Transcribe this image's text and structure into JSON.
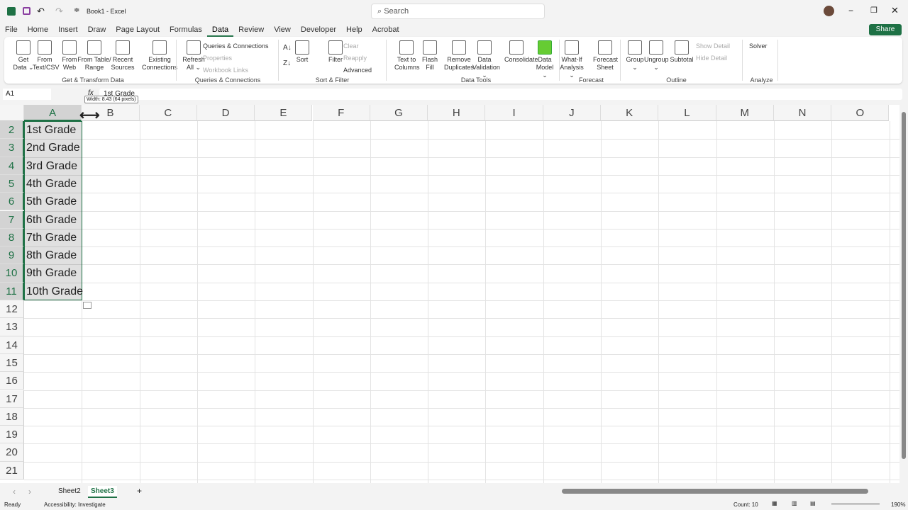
{
  "title": "Book1 - Excel",
  "search_placeholder": "Search",
  "menu": [
    "File",
    "Home",
    "Insert",
    "Draw",
    "Page Layout",
    "Formulas",
    "Data",
    "Review",
    "View",
    "Developer",
    "Help",
    "Acrobat"
  ],
  "share": "Share",
  "ribbon": {
    "big": [
      [
        "Get",
        "Data ⌄"
      ],
      [
        "From",
        "Text/CSV"
      ],
      [
        "From",
        "Web"
      ],
      [
        "From Table/",
        "Range"
      ],
      [
        "Recent",
        "Sources"
      ],
      [
        "Existing",
        "Connections"
      ],
      [
        "Refresh",
        "All ⌄"
      ],
      [
        "Sort",
        ""
      ],
      [
        "Filter",
        ""
      ],
      [
        "Text to",
        "Columns"
      ],
      [
        "Flash",
        "Fill"
      ],
      [
        "Remove",
        "Duplicates"
      ],
      [
        "Data",
        "Validation ⌄"
      ],
      [
        "Consolidate",
        ""
      ],
      [
        "Data",
        "Model ⌄"
      ],
      [
        "What-If",
        "Analysis ⌄"
      ],
      [
        "Forecast",
        "Sheet"
      ],
      [
        "Group",
        "⌄"
      ],
      [
        "Ungroup",
        "⌄"
      ],
      [
        "Subtotal",
        ""
      ]
    ],
    "small": [
      "Queries & Connections",
      "Properties",
      "Workbook Links",
      "Clear",
      "Reapply",
      "Advanced",
      "Show Detail",
      "Hide Detail",
      "Solver"
    ],
    "groups": [
      "Get & Transform Data",
      "Queries & Connections",
      "Sort & Filter",
      "Data Tools",
      "Forecast",
      "Outline",
      "Analyze"
    ]
  },
  "namebox": "A1",
  "formula": "1st Grade",
  "tooltip": "Width: 8.43 (64 pixels)",
  "columns": [
    "A",
    "B",
    "C",
    "D",
    "E",
    "F",
    "G",
    "H",
    "I",
    "J",
    "K",
    "L",
    "M",
    "N",
    "O"
  ],
  "rows": [
    "2",
    "3",
    "4",
    "5",
    "6",
    "7",
    "8",
    "9",
    "10",
    "11",
    "12",
    "13",
    "14",
    "15",
    "16",
    "17",
    "18",
    "19",
    "20",
    "21"
  ],
  "cells": [
    "1st Grade",
    "2nd Grade",
    "3rd Grade",
    "4th Grade",
    "5th Grade",
    "6th Grade",
    "7th Grade",
    "8th Grade",
    "9th Grade",
    "10th Grade"
  ],
  "sheets": [
    "Sheet2",
    "Sheet3"
  ],
  "status": {
    "ready": "Ready",
    "accessibility": "Accessibility: Investigate",
    "count": "Count: 10",
    "zoom": "190%"
  }
}
